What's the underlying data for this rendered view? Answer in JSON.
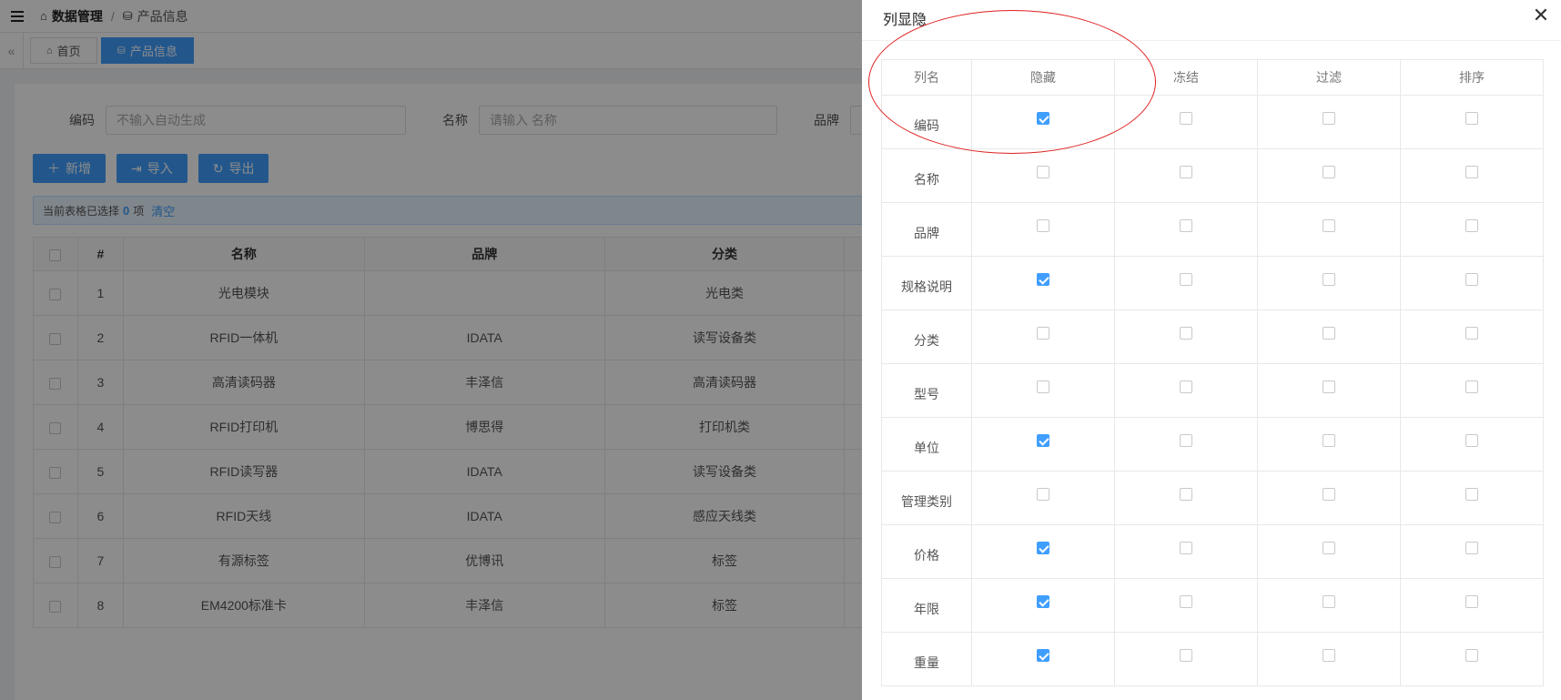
{
  "header": {
    "breadcrumb": [
      "数据管理",
      "产品信息"
    ],
    "breadcrumb_separator": "/"
  },
  "tabs": [
    {
      "label": "首页",
      "icon": "home-icon",
      "active": false
    },
    {
      "label": "产品信息",
      "icon": "database-icon",
      "active": true
    }
  ],
  "search": {
    "fields": [
      {
        "label": "编码",
        "placeholder": "不输入自动生成"
      },
      {
        "label": "名称",
        "placeholder": "请输入 名称"
      },
      {
        "label": "品牌",
        "placeholder": ""
      }
    ]
  },
  "toolbar": {
    "add_label": "新增",
    "import_label": "导入",
    "export_label": "导出"
  },
  "selection": {
    "prefix": "当前表格已选择",
    "count": "0",
    "suffix": "项",
    "clear_label": "清空"
  },
  "table": {
    "columns": [
      "#",
      "名称",
      "品牌",
      "分类"
    ],
    "rows": [
      [
        "1",
        "光电模块",
        "",
        "光电类"
      ],
      [
        "2",
        "RFID一体机",
        "IDATA",
        "读写设备类"
      ],
      [
        "3",
        "高清读码器",
        "丰泽信",
        "高清读码器"
      ],
      [
        "4",
        "RFID打印机",
        "博思得",
        "打印机类"
      ],
      [
        "5",
        "RFID读写器",
        "IDATA",
        "读写设备类"
      ],
      [
        "6",
        "RFID天线",
        "IDATA",
        "感应天线类"
      ],
      [
        "7",
        "有源标签",
        "优博讯",
        "标签"
      ],
      [
        "8",
        "EM4200标准卡",
        "丰泽信",
        "标签"
      ]
    ]
  },
  "drawer": {
    "title": "列显隐",
    "close_icon": "close-icon",
    "columns": [
      "列名",
      "隐藏",
      "冻结",
      "过滤",
      "排序"
    ],
    "rows": [
      {
        "name": "编码",
        "hidden": true,
        "frozen": false,
        "filter": false,
        "sort": false
      },
      {
        "name": "名称",
        "hidden": false,
        "frozen": false,
        "filter": false,
        "sort": false
      },
      {
        "name": "品牌",
        "hidden": false,
        "frozen": false,
        "filter": false,
        "sort": false
      },
      {
        "name": "规格说明",
        "hidden": true,
        "frozen": false,
        "filter": false,
        "sort": false
      },
      {
        "name": "分类",
        "hidden": false,
        "frozen": false,
        "filter": false,
        "sort": false
      },
      {
        "name": "型号",
        "hidden": false,
        "frozen": false,
        "filter": false,
        "sort": false
      },
      {
        "name": "单位",
        "hidden": true,
        "frozen": false,
        "filter": false,
        "sort": false
      },
      {
        "name": "管理类别",
        "hidden": false,
        "frozen": false,
        "filter": false,
        "sort": false
      },
      {
        "name": "价格",
        "hidden": true,
        "frozen": false,
        "filter": false,
        "sort": false
      },
      {
        "name": "年限",
        "hidden": true,
        "frozen": false,
        "filter": false,
        "sort": false
      },
      {
        "name": "重量",
        "hidden": true,
        "frozen": false,
        "filter": false,
        "sort": false
      }
    ]
  },
  "colors": {
    "primary": "#409eff",
    "annotation": "#e02020"
  }
}
